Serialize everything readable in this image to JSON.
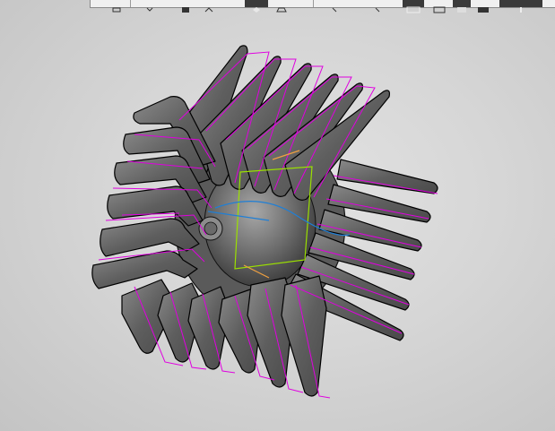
{
  "app": {
    "view": "3d-model-viewport"
  },
  "toolbar": {
    "buttons": [
      {
        "icon": "sketch-icon"
      },
      {
        "icon": "dimension-icon"
      },
      {
        "icon": "shaded-view-icon"
      },
      {
        "icon": "rotate-icon"
      },
      {
        "icon": "orientation-icon"
      },
      {
        "icon": "zoom-icon"
      },
      {
        "icon": "pan-icon"
      },
      {
        "icon": "shaded-with-edges-icon"
      },
      {
        "icon": "wireframe-icon"
      },
      {
        "icon": "section-icon"
      },
      {
        "icon": "display-mode-icon"
      },
      {
        "icon": "perspective-icon"
      },
      {
        "icon": "light-icon"
      }
    ]
  },
  "colors": {
    "background": "#d6d6d6",
    "model_face": "#6e6e6e",
    "model_edge": "#000000",
    "sketch_magenta": "#e000e0",
    "sketch_green": "#9be000",
    "sketch_blue": "#1f7fd6",
    "sketch_orange": "#f0a040"
  }
}
